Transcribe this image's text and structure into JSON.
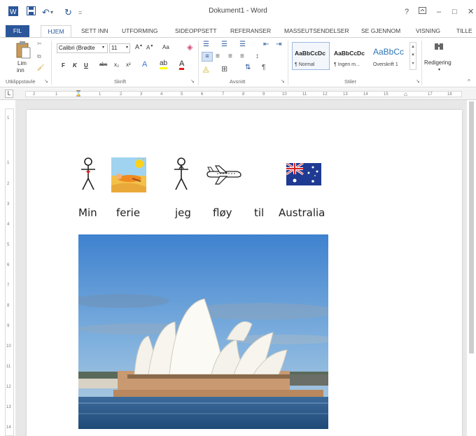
{
  "titlebar": {
    "title": "Dokument1 - Word",
    "help": "?",
    "minimize": "–",
    "restore": "□",
    "close": "✕"
  },
  "tabs": [
    "FIL",
    "HJEM",
    "SETT INN",
    "UTFORMING",
    "SIDEOPPSETT",
    "REFERANSER",
    "MASSEUTSENDELSER",
    "SE GJENNOM",
    "VISNING",
    "TILLE"
  ],
  "ribbon": {
    "clipboard": {
      "paste_label_1": "Lim",
      "paste_label_2": "inn",
      "group": "Utklippstavle"
    },
    "font": {
      "name": "Calibri (Brødte",
      "size": "11",
      "aa": "Aa",
      "bold": "F",
      "italic": "K",
      "underline": "U",
      "strike": "abc",
      "sub": "x₂",
      "sup": "x²",
      "group": "Skrift"
    },
    "paragraph": {
      "group": "Avsnitt"
    },
    "styles": {
      "items": [
        {
          "preview": "AaBbCcDc",
          "name": "¶ Normal"
        },
        {
          "preview": "AaBbCcDc",
          "name": "¶ Ingen m..."
        },
        {
          "preview": "AaBbCc",
          "name": "Overskrift 1"
        }
      ],
      "group": "Stiler"
    },
    "editing": {
      "label": "Redigering"
    }
  },
  "ruler": {
    "numbers": [
      "2",
      "1",
      "1",
      "2",
      "3",
      "4",
      "5",
      "6",
      "7",
      "8",
      "9",
      "10",
      "11",
      "12",
      "13",
      "14",
      "15",
      "17",
      "18"
    ]
  },
  "vruler": {
    "numbers": [
      "1",
      "1",
      "2",
      "3",
      "4",
      "5",
      "6",
      "7",
      "8",
      "9",
      "10",
      "11",
      "12",
      "13",
      "14"
    ]
  },
  "document": {
    "words": [
      "Min",
      "ferie",
      "jeg",
      "fløy",
      "til",
      "Australia"
    ]
  },
  "colors": {
    "accent": "#2b579a",
    "sky": "#5d93c9",
    "flag_blue": "#1f3a93"
  }
}
